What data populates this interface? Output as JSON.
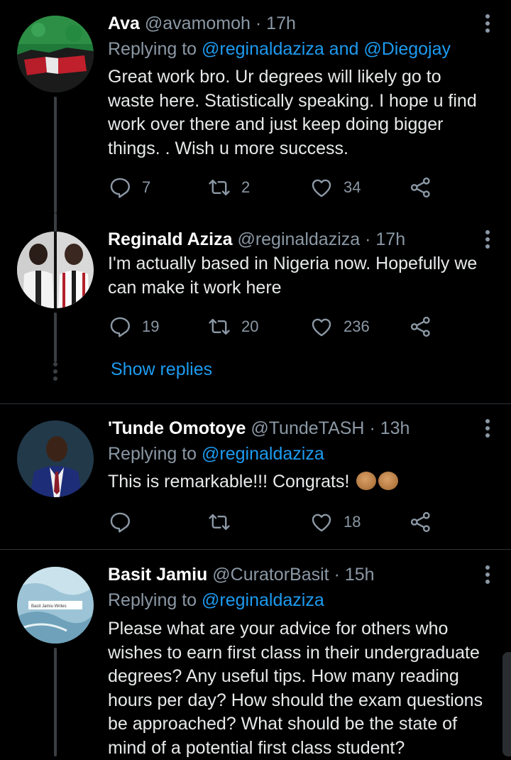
{
  "tweets": [
    {
      "name": "Ava",
      "handle": "@avamomoh",
      "time": "· 17h",
      "replying_prefix": "Replying to",
      "replying_mentions": "@reginaldaziza and @Diegojay",
      "text": "Great work bro. Ur degrees will likely go to waste here. Statistically speaking. I hope u find work over there and just keep doing bigger things. . Wish u more success.",
      "replies": "7",
      "retweets": "2",
      "likes": "34"
    },
    {
      "name": "Reginald Aziza",
      "handle": "@reginaldaziza",
      "time": "· 17h",
      "text": "I'm actually based in Nigeria now. Hopefully we can make it work here",
      "replies": "19",
      "retweets": "20",
      "likes": "236"
    },
    {
      "name": "'Tunde Omotoye",
      "handle": "@TundeTASH",
      "time": "· 13h",
      "replying_prefix": "Replying to",
      "replying_mentions": "@reginaldaziza",
      "text": "This is remarkable!!! Congrats!",
      "replies": "",
      "retweets": "",
      "likes": "18"
    },
    {
      "name": "Basit Jamiu",
      "handle": "@CuratorBasit",
      "time": "· 15h",
      "replying_prefix": "Replying to",
      "replying_mentions": "@reginaldaziza",
      "text": "Please what are your advice for others who wishes to earn first class in their undergraduate degrees? Any useful tips. How many reading hours per day? How should the exam questions be approached? What should be the state of mind of a potential first class student?"
    }
  ],
  "show_replies_label": "Show replies",
  "avatar_tiny_text": "Basit Jamiu Writes",
  "colors": {
    "link": "#1d9bf0",
    "muted": "#8b98a5",
    "background": "#000000"
  }
}
